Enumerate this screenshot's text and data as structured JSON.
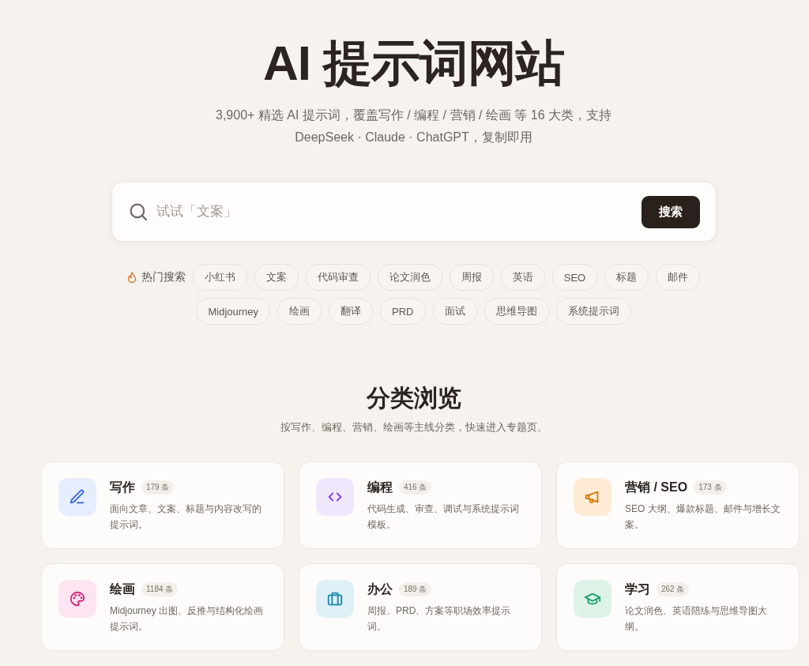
{
  "hero": {
    "title": "AI 提示词网站",
    "subtitle": "3,900+ 精选 AI 提示词，覆盖写作 / 编程 / 营销 / 绘画 等 16 大类，支持 DeepSeek · Claude · ChatGPT，复制即用"
  },
  "search": {
    "placeholder": "试试「文案」",
    "button": "搜索"
  },
  "hot_searches": {
    "label": "热门搜索",
    "items": [
      "小红书",
      "文案",
      "代码审查",
      "论文润色",
      "周报",
      "英语",
      "SEO",
      "标题",
      "邮件",
      "Midjourney",
      "绘画",
      "翻译",
      "PRD",
      "面试",
      "思维导图",
      "系统提示词"
    ]
  },
  "categories_section": {
    "title": "分类浏览",
    "subtitle": "按写作、编程、营销、绘画等主线分类，快速进入专题页。",
    "categories": [
      {
        "name": "写作",
        "count": "179 条",
        "description": "面向文章、文案、标题与内容改写的提示词。"
      },
      {
        "name": "编程",
        "count": "416 条",
        "description": "代码生成、审查、调试与系统提示词模板。"
      },
      {
        "name": "营销 / SEO",
        "count": "173 条",
        "description": "SEO 大纲、爆款标题、邮件与增长文案。"
      },
      {
        "name": "绘画",
        "count": "1184 条",
        "description": "Midjourney 出图、反推与结构化绘画提示词。"
      },
      {
        "name": "办公",
        "count": "189 条",
        "description": "周报、PRD、方案等职场效率提示词。"
      },
      {
        "name": "学习",
        "count": "262 条",
        "description": "论文润色、英语陪练与思维导图大纲。"
      }
    ]
  }
}
